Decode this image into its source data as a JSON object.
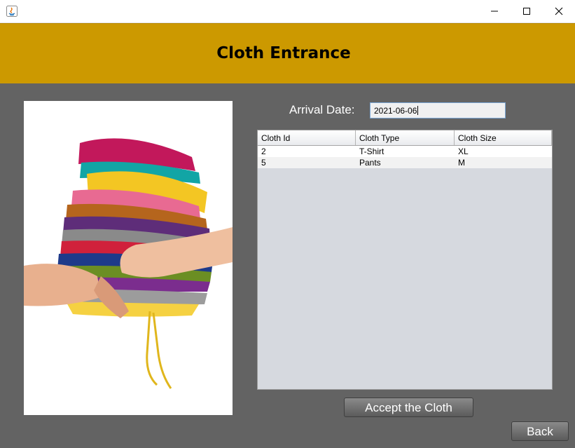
{
  "window": {
    "minimize": "minimize",
    "maximize": "maximize",
    "close": "close"
  },
  "header": {
    "title": "Cloth Entrance",
    "bg_color": "#cc9900"
  },
  "form": {
    "arrival_label": "Arrival Date:",
    "arrival_value": "2021-06-06"
  },
  "table": {
    "columns": [
      "Cloth Id",
      "Cloth Type",
      "Cloth Size"
    ],
    "rows": [
      [
        "2",
        "T-Shirt",
        "XL"
      ],
      [
        "5",
        "Pants",
        "M"
      ]
    ]
  },
  "buttons": {
    "accept": "Accept the Cloth",
    "back": "Back"
  },
  "image": {
    "subject": "stack of colorful folded clothes held by hands"
  }
}
